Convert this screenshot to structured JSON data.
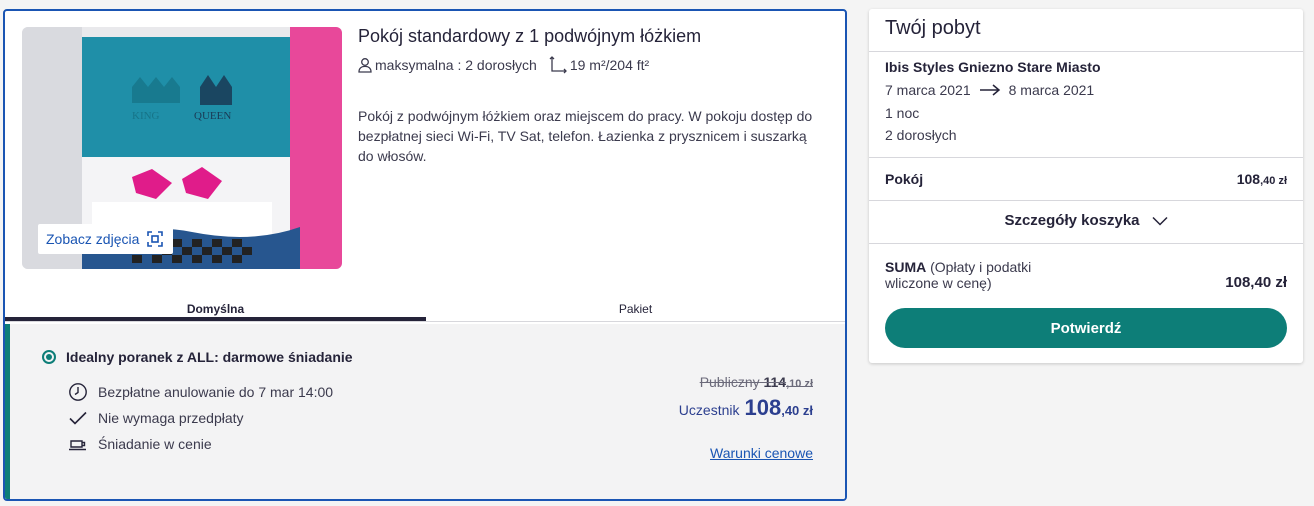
{
  "room": {
    "title": "Pokój standardowy z 1 podwójnym łóżkiem",
    "capacity": "maksymalna : 2 dorosłych",
    "area": "19 m²/204 ft²",
    "description": "Pokój z podwójnym łóżkiem oraz miejscem do pracy. W pokoju dostęp do bezpłatnej sieci Wi-Fi, TV Sat, telefon. Łazienka z prysznicem i suszarką do włosów.",
    "see_photos": "Zobacz zdjęcia",
    "photo_signs": [
      "KING",
      "QUEEN"
    ]
  },
  "tabs": [
    {
      "label": "Domyślna",
      "active": true
    },
    {
      "label": "Pakiet",
      "active": false
    }
  ],
  "offer": {
    "title": "Idealny poranek z ALL: darmowe śniadanie",
    "features": [
      {
        "icon": "clock-icon",
        "text": "Bezpłatne anulowanie do 7 mar 14:00"
      },
      {
        "icon": "checkmark-icon",
        "text": "Nie wymaga przedpłaty"
      },
      {
        "icon": "coffee-cup-icon",
        "text": "Śniadanie w cenie"
      }
    ],
    "public_label": "Publiczny",
    "public_price_main": "114",
    "public_price_cents": ",10 zł",
    "member_label": "Uczestnik",
    "member_price_main": "108",
    "member_price_cents": ",40 zł",
    "terms_link": "Warunki cenowe"
  },
  "summary": {
    "title": "Twój pobyt",
    "hotel": "Ibis Styles Gniezno Stare Miasto",
    "checkin": "7 marca 2021",
    "checkout": "8 marca 2021",
    "nights": "1 noc",
    "guests": "2 dorosłych",
    "room_label": "Pokój",
    "room_price_main": "108",
    "room_price_cents": ",40 zł",
    "cart_details": "Szczegóły koszyka",
    "total_label": "SUMA",
    "total_note": "(Opłaty i podatki wliczone w cenę)",
    "total_value": "108,40 zł",
    "confirm": "Potwierdź"
  },
  "colors": {
    "accent_teal": "#0d7e78",
    "link_blue": "#1a55b3",
    "price_navy": "#2c3f8f",
    "wall_blue": "#1f8fa8",
    "wall_pink": "#e8489a"
  }
}
